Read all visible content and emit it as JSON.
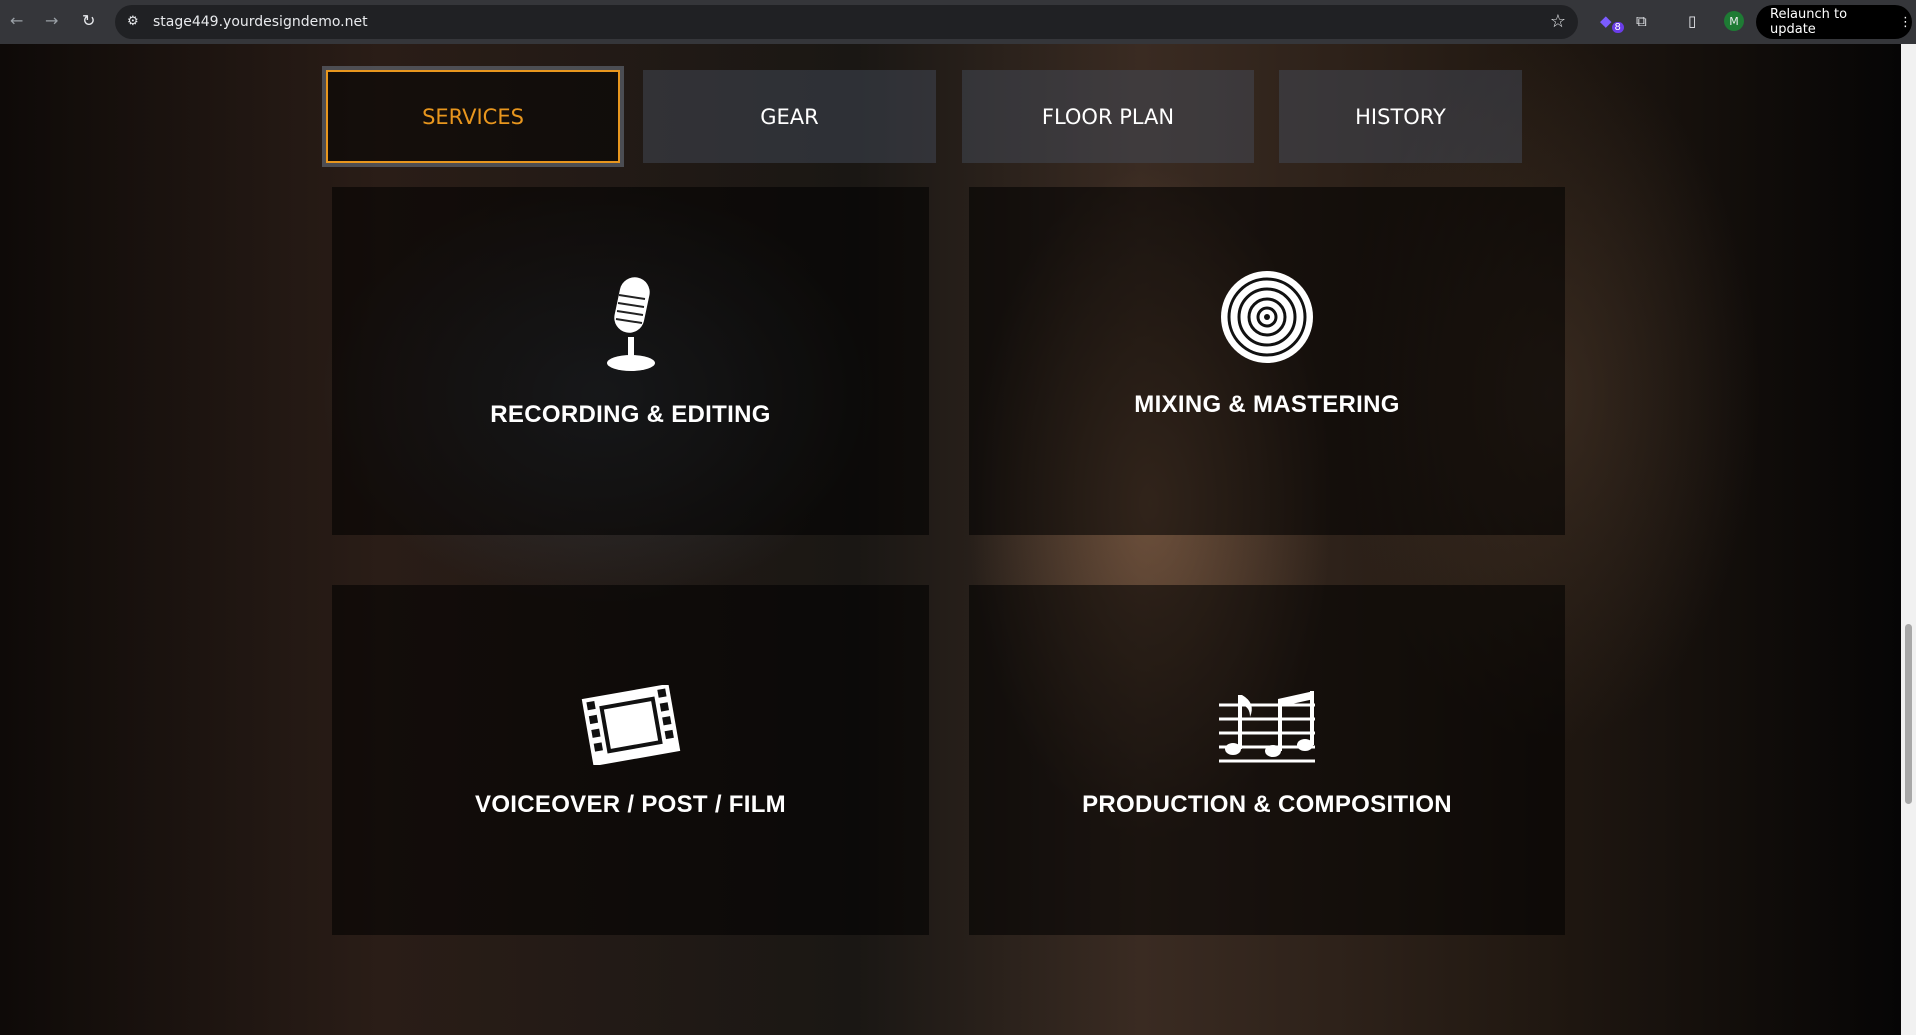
{
  "browser": {
    "url": "stage449.yourdesigndemo.net",
    "extension_badge": "8",
    "profile_initial": "M",
    "relaunch_label": "Relaunch to update"
  },
  "tabs": [
    {
      "label": "SERVICES",
      "active": true
    },
    {
      "label": "GEAR"
    },
    {
      "label": "FLOOR PLAN"
    },
    {
      "label": "HISTORY"
    }
  ],
  "services": [
    {
      "title": "RECORDING & EDITING",
      "icon": "microphone-icon"
    },
    {
      "title": "MIXING & MASTERING",
      "icon": "vinyl-record-icon"
    },
    {
      "title": "VOICEOVER / POST / FILM",
      "icon": "film-strip-icon"
    },
    {
      "title": "PRODUCTION & COMPOSITION",
      "icon": "sheet-music-icon"
    }
  ],
  "colors": {
    "accent": "#e8961e"
  }
}
